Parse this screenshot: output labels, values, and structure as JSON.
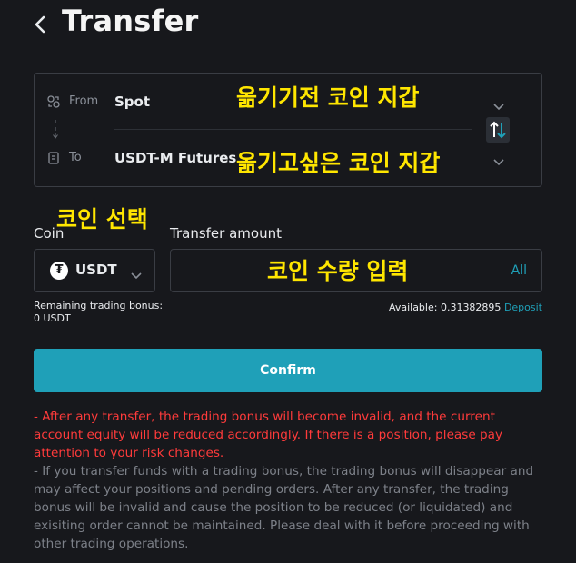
{
  "header": {
    "title": "Transfer"
  },
  "from": {
    "label": "From",
    "value": "Spot",
    "annotation": "옮기기전 코인 지갑"
  },
  "to": {
    "label": "To",
    "value": "USDT-M Futures",
    "annotation": "옮기고싶은 코인 지갑"
  },
  "coin": {
    "label": "Coin",
    "annotation": "코인 선택",
    "selected": "USDT",
    "icon": "tether-icon"
  },
  "amount": {
    "label": "Transfer amount",
    "annotation": "코인 수량 입력",
    "all_label": "All",
    "value": ""
  },
  "bonus": {
    "label": "Remaining trading bonus:",
    "value": "0 USDT"
  },
  "available": {
    "label": "Available: 0.31382895",
    "deposit_label": "Deposit"
  },
  "confirm_label": "Confirm",
  "notices": {
    "warning": "- After any transfer, the trading bonus will become invalid, and the current account equity will be reduced accordingly. If there is a position, please pay attention to your risk changes.",
    "info": "- If you transfer funds with a trading bonus, the trading bonus will disappear and may affect your positions and pending orders. After any transfer, the trading bonus will be invalid and cause the position to be reduced (or liquidated) and exisiting order cannot be maintained. Please deal with it before proceeding with other trading operations."
  },
  "colors": {
    "accent": "#1fa0b8",
    "warning": "#ff3b3b",
    "annotation": "#ffe600",
    "background": "#17181c"
  }
}
